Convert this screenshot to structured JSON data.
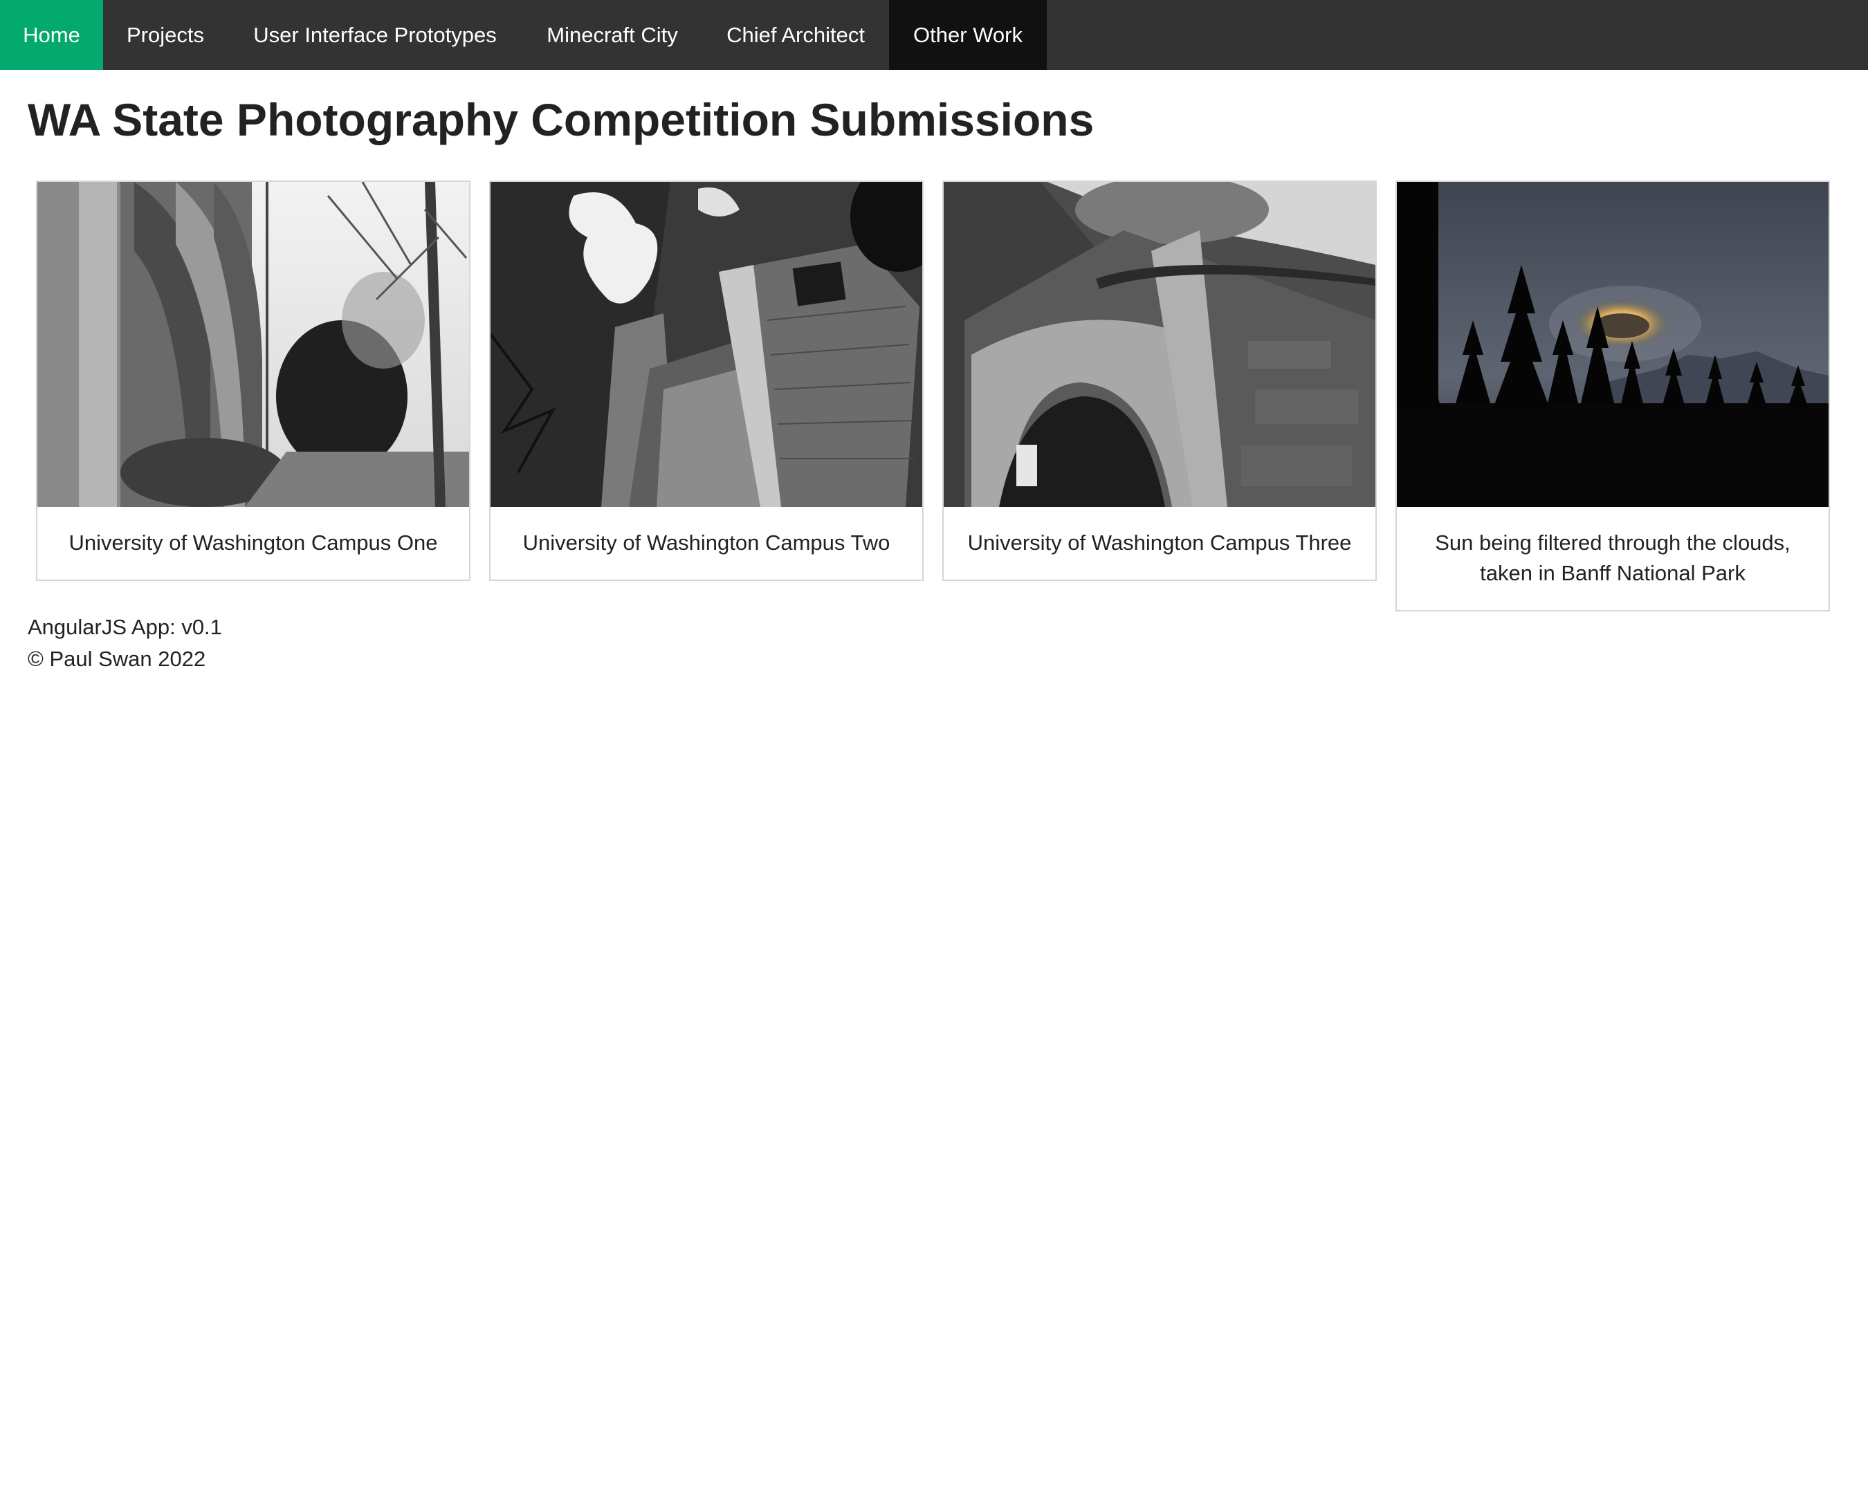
{
  "nav": {
    "items": [
      {
        "label": "Home"
      },
      {
        "label": "Projects"
      },
      {
        "label": "User Interface Prototypes"
      },
      {
        "label": "Minecraft City"
      },
      {
        "label": "Chief Architect"
      },
      {
        "label": "Other Work"
      }
    ],
    "active_color": "#04aa6d",
    "bar_color": "#333333"
  },
  "page": {
    "title": "WA State Photography Competition Submissions"
  },
  "gallery": [
    {
      "caption": "University of Washington Campus One"
    },
    {
      "caption": "University of Washington Campus Two"
    },
    {
      "caption": "University of Washington Campus Three"
    },
    {
      "caption": "Sun being filtered through the clouds, taken in Banff National Park"
    }
  ],
  "footer": {
    "version": "AngularJS App: v0.1",
    "copyright": "© Paul Swan 2022"
  }
}
